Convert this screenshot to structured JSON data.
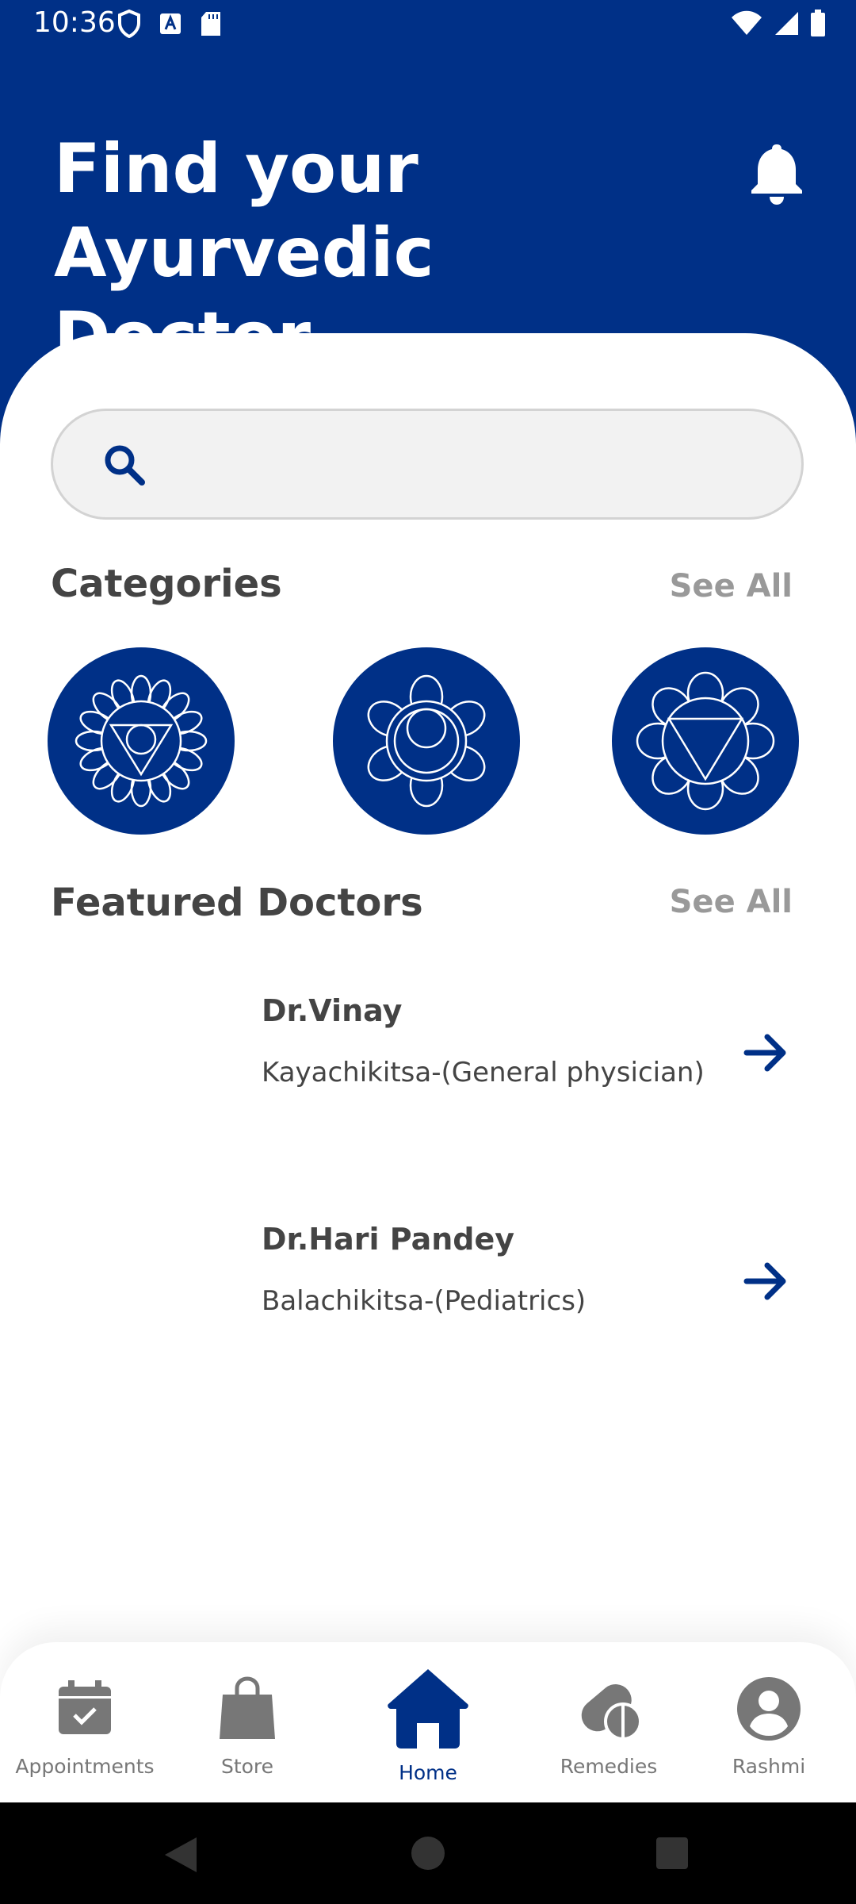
{
  "status_bar": {
    "time": "10:36"
  },
  "header": {
    "title": "Find your Ayurvedic Doctor"
  },
  "search": {
    "placeholder": ""
  },
  "categories": {
    "title": "Categories",
    "see_all": "See All"
  },
  "featured": {
    "title": "Featured Doctors",
    "see_all": "See All"
  },
  "doctors": [
    {
      "name": "Dr.Vinay",
      "specialty": "Kayachikitsa-(General physician)"
    },
    {
      "name": "Dr.Hari Pandey",
      "specialty": "Balachikitsa-(Pediatrics)"
    }
  ],
  "nav": [
    {
      "label": "Appointments",
      "icon": "calendar-check-icon"
    },
    {
      "label": "Store",
      "icon": "shopping-bag-icon"
    },
    {
      "label": "Home",
      "icon": "home-icon",
      "active": true
    },
    {
      "label": "Remedies",
      "icon": "pills-icon"
    },
    {
      "label": "Rashmi",
      "icon": "account-circle-icon"
    }
  ],
  "colors": {
    "primary": "#003087",
    "inactive": "#777777",
    "muted": "#999999"
  }
}
